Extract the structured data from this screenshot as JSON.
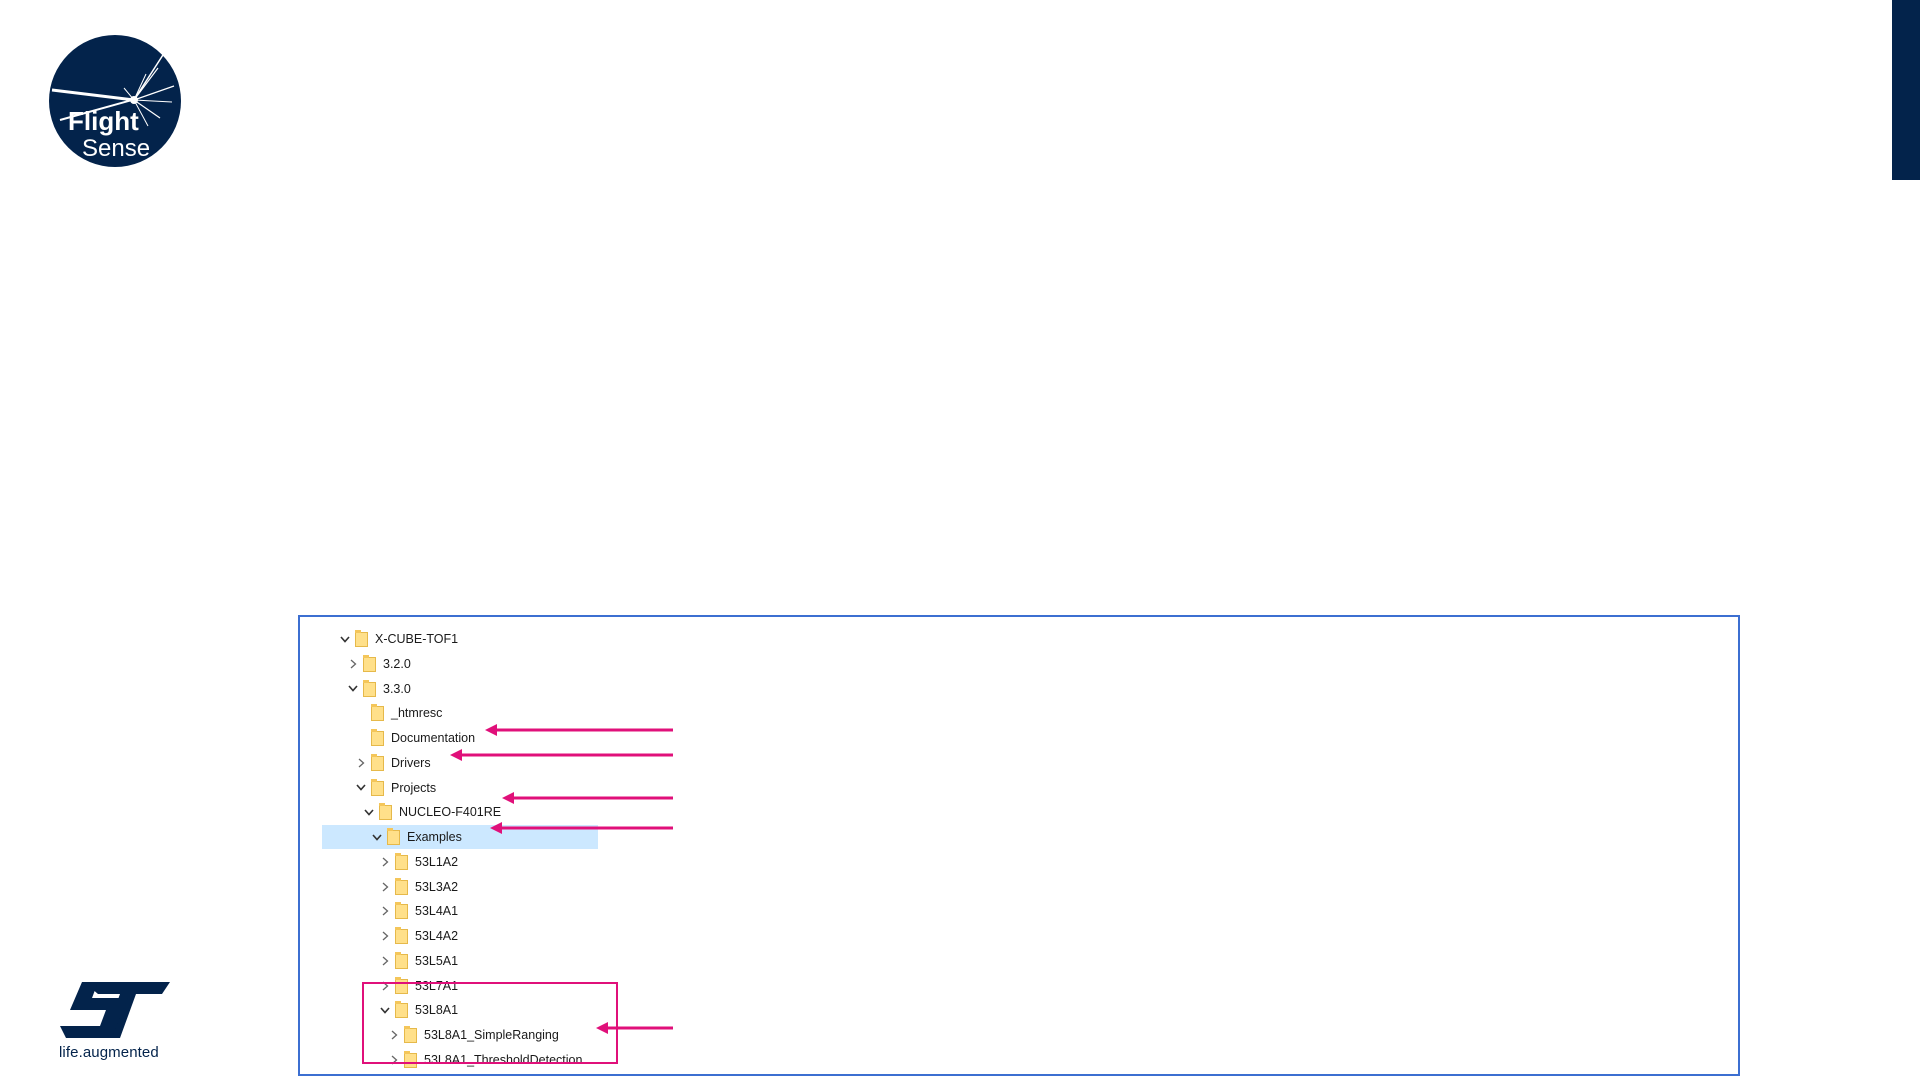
{
  "branding": {
    "flightsense_line1": "Flight",
    "flightsense_line2": "Sense",
    "st_tagline": "life.augmented",
    "colors": {
      "navy": "#03234b",
      "pink": "#e0107a",
      "frame": "#3c6fd1",
      "selection": "#cce8ff"
    }
  },
  "tree": {
    "items": [
      {
        "label": "X-CUBE-TOF1",
        "expander": "chevron-down"
      },
      {
        "label": "3.2.0",
        "expander": "chevron-right"
      },
      {
        "label": "3.3.0",
        "expander": "chevron-down"
      },
      {
        "label": "_htmresc",
        "expander": "none"
      },
      {
        "label": "Documentation",
        "expander": "none"
      },
      {
        "label": "Drivers",
        "expander": "chevron-right"
      },
      {
        "label": "Projects",
        "expander": "chevron-down"
      },
      {
        "label": "NUCLEO-F401RE",
        "expander": "chevron-down"
      },
      {
        "label": "Examples",
        "expander": "chevron-down",
        "selected": true
      },
      {
        "label": "53L1A2",
        "expander": "chevron-right"
      },
      {
        "label": "53L3A2",
        "expander": "chevron-right"
      },
      {
        "label": "53L4A1",
        "expander": "chevron-right"
      },
      {
        "label": "53L4A2",
        "expander": "chevron-right"
      },
      {
        "label": "53L5A1",
        "expander": "chevron-right"
      },
      {
        "label": "53L7A1",
        "expander": "chevron-right"
      },
      {
        "label": "53L8A1",
        "expander": "chevron-down"
      },
      {
        "label": "53L8A1_SimpleRanging",
        "expander": "chevron-right"
      },
      {
        "label": "53L8A1_ThresholdDetection",
        "expander": "chevron-right"
      }
    ]
  }
}
